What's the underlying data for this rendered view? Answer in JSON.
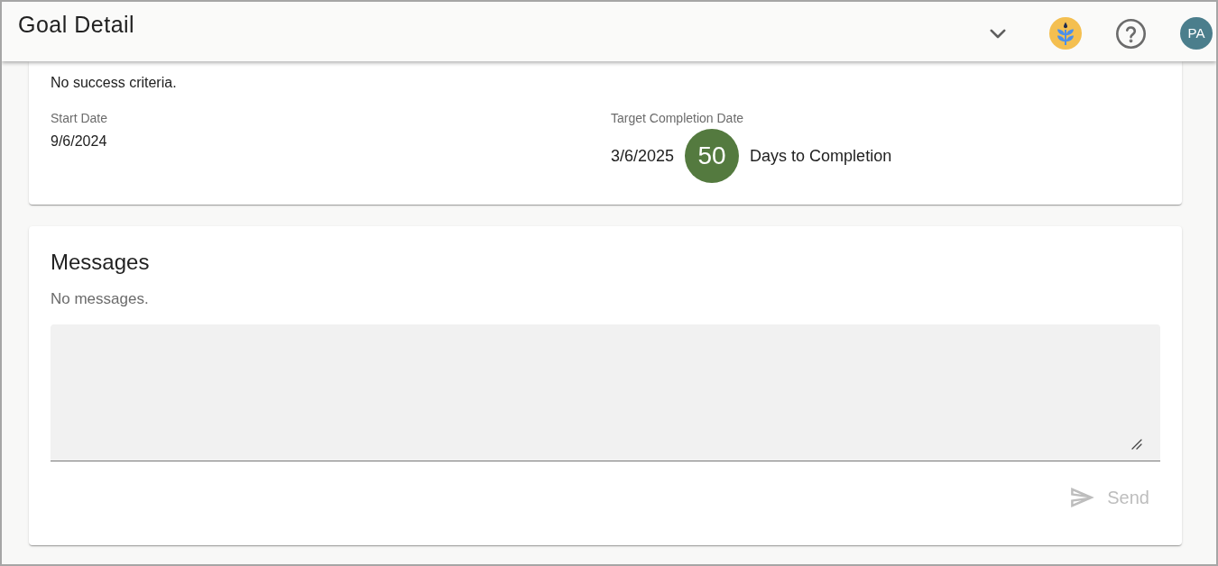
{
  "header": {
    "title": "Goal Detail",
    "avatar_initials": "PA"
  },
  "goal_card": {
    "success_criteria": "No success criteria.",
    "start_date": {
      "label": "Start Date",
      "value": "9/6/2024"
    },
    "target_completion": {
      "label": "Target Completion Date",
      "value": "3/6/2025",
      "days_remaining": "50",
      "days_caption": "Days to Completion"
    }
  },
  "messages": {
    "title": "Messages",
    "empty_text": "No messages.",
    "send_button": {
      "label": "Send",
      "disabled": true
    }
  }
}
